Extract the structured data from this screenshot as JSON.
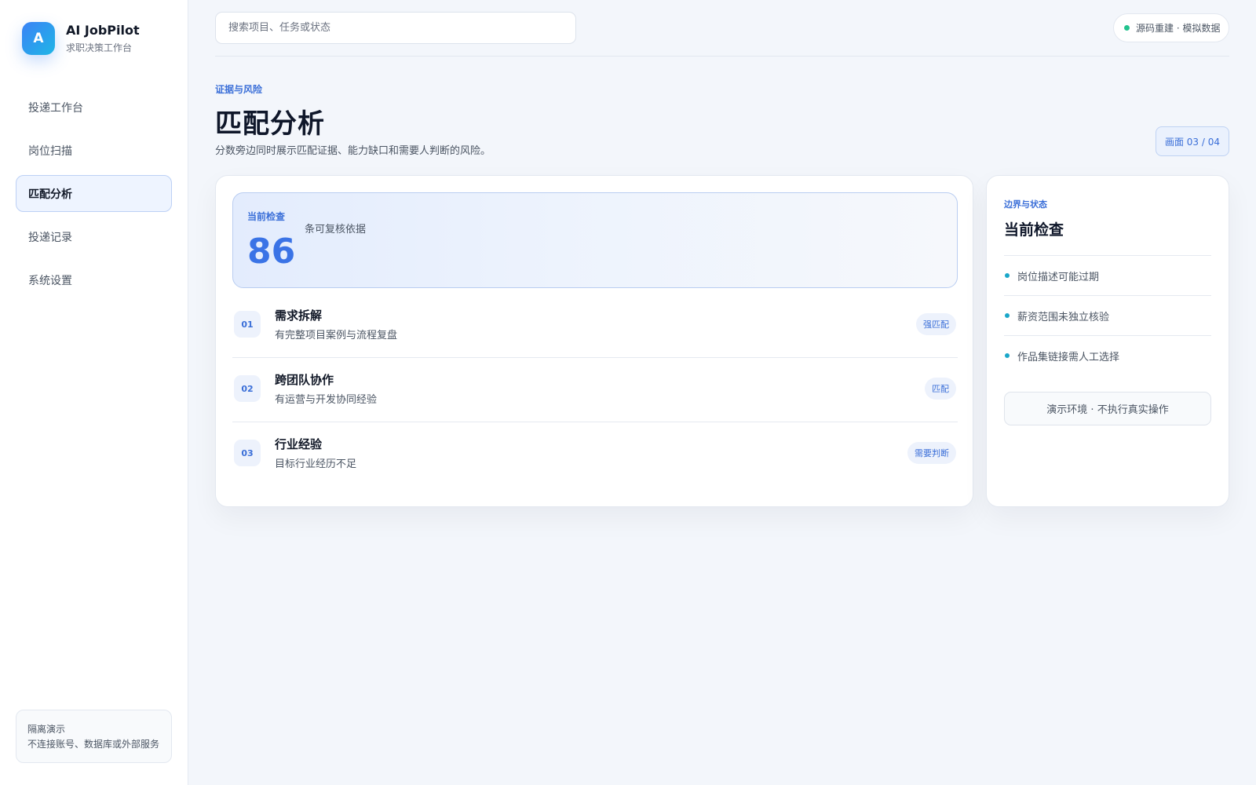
{
  "brand": {
    "logo_letter": "A",
    "title": "AI JobPilot",
    "subtitle": "求职决策工作台"
  },
  "sidebar": {
    "items": [
      {
        "label": "投递工作台",
        "active": false
      },
      {
        "label": "岗位扫描",
        "active": false
      },
      {
        "label": "匹配分析",
        "active": true
      },
      {
        "label": "投递记录",
        "active": false
      },
      {
        "label": "系统设置",
        "active": false
      }
    ],
    "note": {
      "title": "隔离演示",
      "text": "不连接账号、数据库或外部服务"
    }
  },
  "search": {
    "placeholder": "搜索项目、任务或状态",
    "value": ""
  },
  "status": {
    "text": "源码重建 · 模拟数据",
    "dot_color": "#22c38e"
  },
  "header": {
    "eyebrow": "证据与风险",
    "title": "匹配分析",
    "description": "分数旁边同时展示匹配证据、能力缺口和需要人判断的风险。",
    "screen_badge": "画面 03 / 04"
  },
  "metric": {
    "label": "当前检查",
    "value": "86",
    "caption": "条可复核依据"
  },
  "rows": [
    {
      "num": "01",
      "title": "需求拆解",
      "desc": "有完整项目案例与流程复盘",
      "tag": "强匹配"
    },
    {
      "num": "02",
      "title": "跨团队协作",
      "desc": "有运营与开发协同经验",
      "tag": "匹配"
    },
    {
      "num": "03",
      "title": "行业经验",
      "desc": "目标行业经历不足",
      "tag": "需要判断"
    }
  ],
  "side": {
    "eyebrow": "边界与状态",
    "title": "当前检查",
    "items": [
      "岗位描述可能过期",
      "薪资范围未独立核验",
      "作品集链接需人工选择"
    ],
    "footer": "演示环境 · 不执行真实操作"
  },
  "colors": {
    "accent": "#3b6fd8",
    "metric_value": "#3a73e6",
    "bullet": "#1aa7c9"
  }
}
